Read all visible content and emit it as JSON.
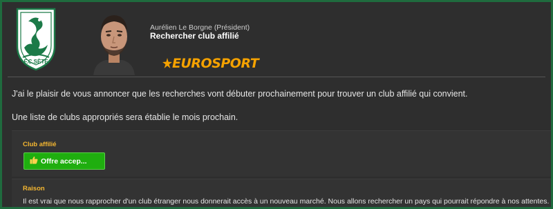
{
  "club": {
    "name": "F.C.SÈTE",
    "crest": "club-crest-icon"
  },
  "header": {
    "sender": "Aurélien Le Borgne  (Président)",
    "subject": "Rechercher club affilié",
    "source_logo": "EUROSPORT"
  },
  "message": {
    "line1": "J'ai le plaisir de vous annoncer que les recherches vont débuter prochainement pour trouver un club affilié qui convient.",
    "line2": "Une liste de clubs appropriés sera établie le mois prochain."
  },
  "affiliate": {
    "label": "Club affilié",
    "button_label": "Offre accep...",
    "button_icon": "thumbs-up-icon"
  },
  "reason": {
    "label": "Raison",
    "text": "Il est vrai que nous rapprocher d'un club étranger nous donnerait accès à un nouveau marché. Nous allons rechercher un pays qui pourrait répondre à nos attentes."
  },
  "colors": {
    "frame": "#1f6b3e",
    "background": "#2e2e2e",
    "accent_label": "#f5b731",
    "logo": "#f5a200",
    "button": "#1fae0f"
  }
}
